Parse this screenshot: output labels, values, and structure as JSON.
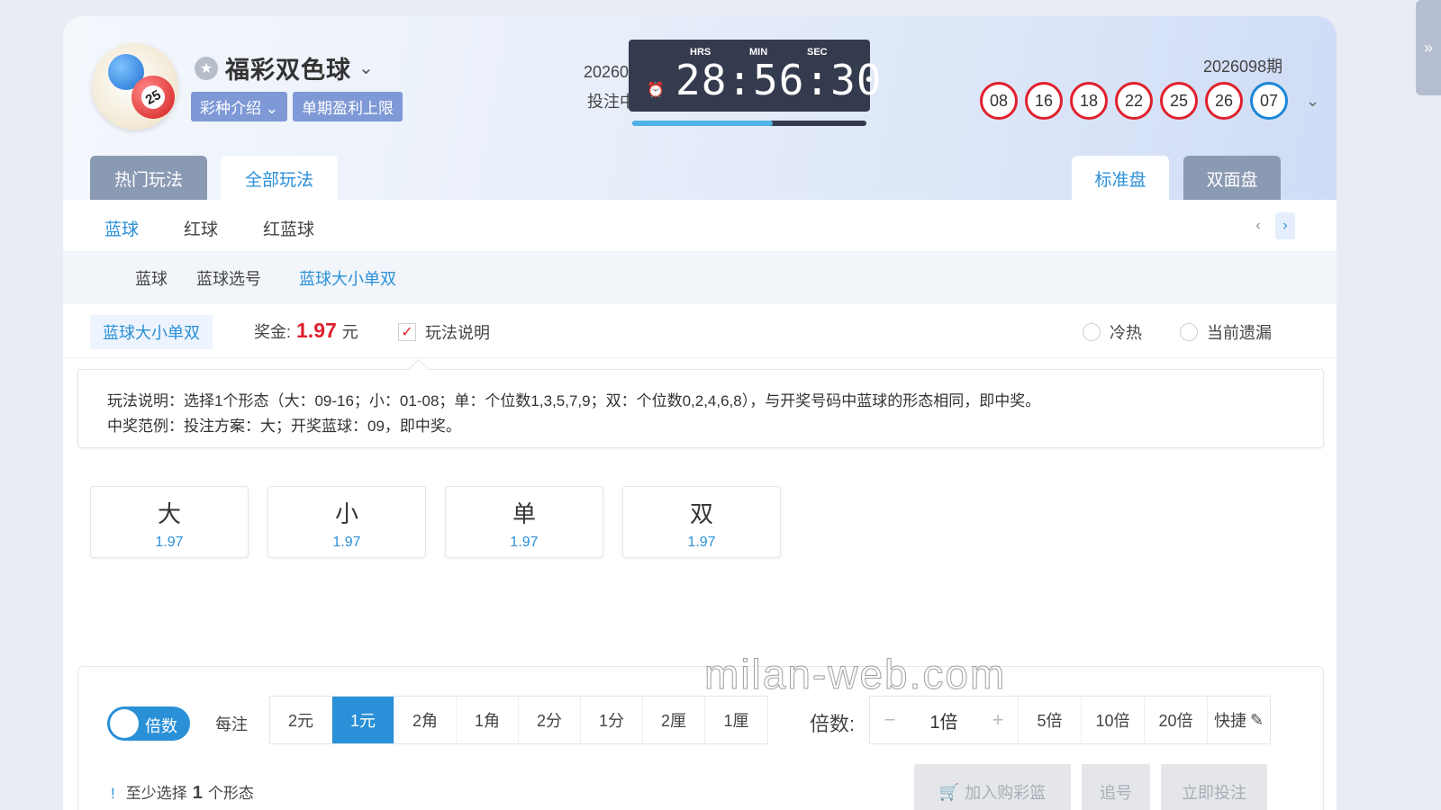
{
  "side_tab": {
    "icon": "double-chevron-right-icon",
    "glyph": "»"
  },
  "lottery": {
    "title": "福彩双色球",
    "badges": [
      "彩种介绍 ⌄",
      "单期盈利上限"
    ],
    "current_issue": "2026099期",
    "status": "投注中",
    "timer": {
      "hrs_label": "HRS",
      "min_label": "MIN",
      "sec_label": "SEC",
      "value": "28:56:30",
      "progress": 0.6
    },
    "prev_issue": "2026098期",
    "red_balls": [
      "08",
      "16",
      "18",
      "22",
      "25",
      "26"
    ],
    "blue_ball": "07"
  },
  "tabs": {
    "hot": "热门玩法",
    "all": "全部玩法",
    "standard": "标准盘",
    "double": "双面盘"
  },
  "subnav": [
    "蓝球",
    "红球",
    "红蓝球"
  ],
  "subnav2": [
    "蓝球",
    "蓝球选号",
    "蓝球大小单双"
  ],
  "play": {
    "name": "蓝球大小单双",
    "prize_label": "奖金:",
    "prize": "1.97",
    "unit": "元",
    "rules_label": "玩法说明",
    "cold_hot": "冷热",
    "missing": "当前遗漏"
  },
  "description": {
    "line1": "玩法说明：选择1个形态（大：09-16；小：01-08；单：个位数1,3,5,7,9；双：个位数0,2,4,6,8），与开奖号码中蓝球的形态相同，即中奖。",
    "line2": "中奖范例：投注方案：大；开奖蓝球：09，即中奖。"
  },
  "options": [
    {
      "label": "大",
      "odds": "1.97"
    },
    {
      "label": "小",
      "odds": "1.97"
    },
    {
      "label": "单",
      "odds": "1.97"
    },
    {
      "label": "双",
      "odds": "1.97"
    }
  ],
  "bet": {
    "toggle": "倍数",
    "per_label": "每注",
    "units": [
      "2元",
      "1元",
      "2角",
      "1角",
      "2分",
      "1分",
      "2厘",
      "1厘"
    ],
    "active_unit": "1元",
    "mult_label": "倍数:",
    "minus": "−",
    "mult_value": "1倍",
    "plus": "+",
    "quick": [
      "5倍",
      "10倍",
      "20倍",
      "快捷"
    ],
    "hint_prefix": "至少选择",
    "hint_num": "1",
    "hint_suffix": "个形态",
    "add_cart": "加入购彩篮",
    "chase": "追号",
    "bet_now": "立即投注"
  },
  "watermark": "milan-web.com"
}
